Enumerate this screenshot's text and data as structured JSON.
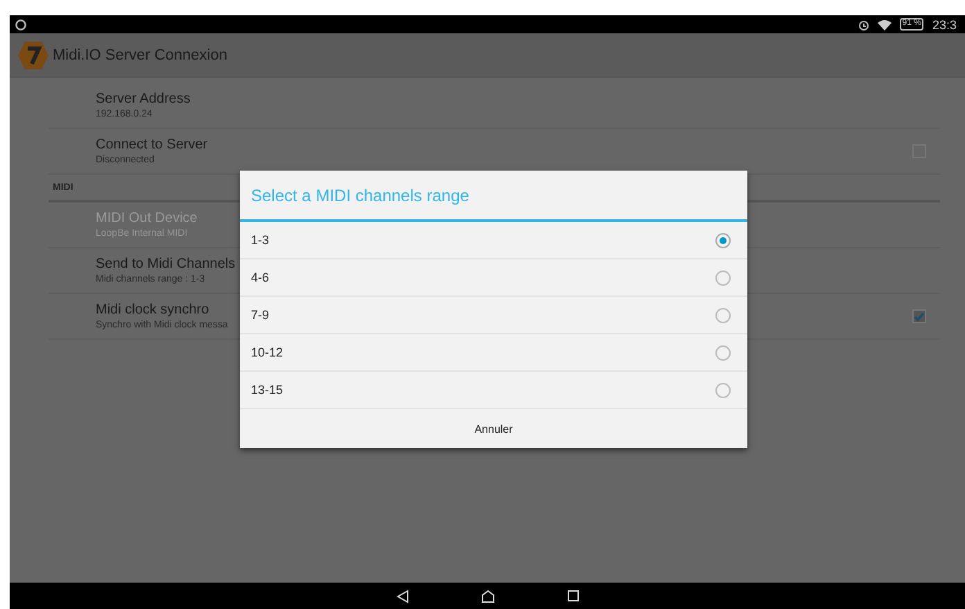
{
  "status_bar": {
    "battery": "91 %",
    "time": "23:3"
  },
  "app_bar": {
    "title": "Midi.IO Server Connexion"
  },
  "preferences": [
    {
      "kind": "item",
      "title": "Server Address",
      "summary": "192.168.0.24",
      "disabled": false
    },
    {
      "kind": "checkbox",
      "title": "Connect to Server",
      "summary": "Disconnected",
      "disabled": false,
      "checked": false
    },
    {
      "kind": "category",
      "title": "MIDI"
    },
    {
      "kind": "item",
      "title": "MIDI Out Device",
      "summary": "LoopBe Internal MIDI",
      "disabled": true
    },
    {
      "kind": "item",
      "title": "Send to Midi Channels",
      "summary": "Midi channels range : 1-3",
      "disabled": false
    },
    {
      "kind": "checkbox",
      "title": "Midi clock synchro",
      "summary": "Synchro with Midi clock messa",
      "disabled": false,
      "checked": true
    }
  ],
  "dialog": {
    "title": "Select a MIDI channels range",
    "options": [
      {
        "label": "1-3",
        "selected": true
      },
      {
        "label": "4-6",
        "selected": false
      },
      {
        "label": "7-9",
        "selected": false
      },
      {
        "label": "10-12",
        "selected": false
      },
      {
        "label": "13-15",
        "selected": false
      }
    ],
    "cancel": "Annuler"
  }
}
